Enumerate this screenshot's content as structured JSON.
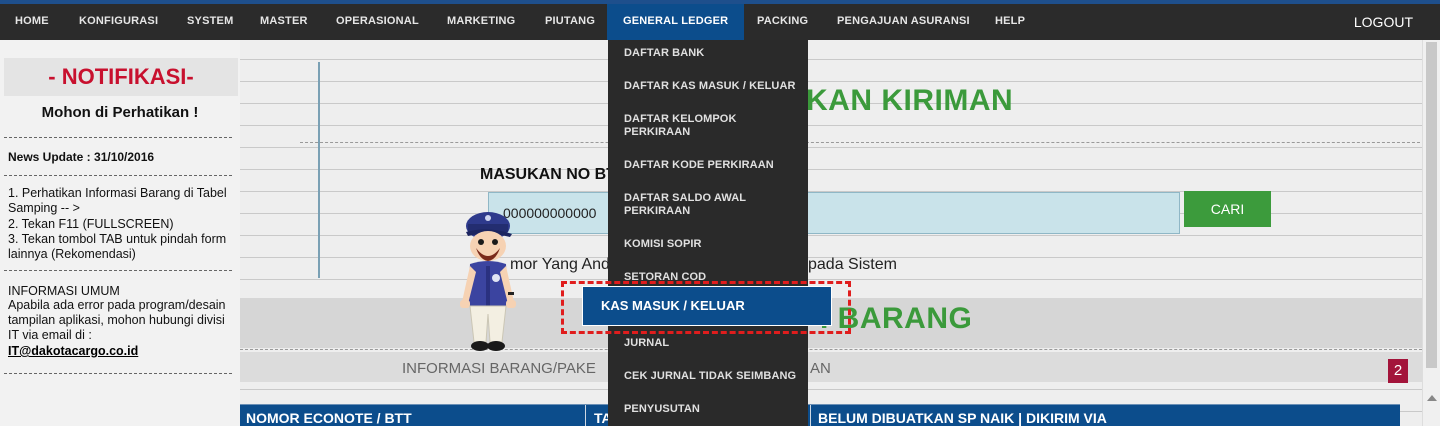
{
  "nav": {
    "items": [
      "HOME",
      "KONFIGURASI",
      "SYSTEM",
      "MASTER",
      "OPERASIONAL",
      "MARKETING",
      "PIUTANG",
      "GENERAL LEDGER",
      "PACKING",
      "PENGAJUAN ASURANSI",
      "HELP"
    ],
    "active": "GENERAL LEDGER",
    "logout": "LOGOUT"
  },
  "sidebar": {
    "title": "- NOTIFIKASI-",
    "subtitle": "Mohon di Perhatikan !",
    "news": "News Update : 31/10/2016",
    "steps": [
      "1. Perhatikan Informasi Barang di Tabel Samping -- >",
      "2. Tekan F11 (FULLSCREEN)",
      "3. Tekan tombol TAB untuk pindah form lainnya (Rekomendasi)"
    ],
    "info_title": "INFORMASI UMUM",
    "info_text": "Apabila ada error pada program/desain tampilan aplikasi, mohon hubungi divisi IT via email di :",
    "email": "IT@dakotacargo.co.id"
  },
  "main": {
    "heading1": "KAN KIRIMAN",
    "field_label": "MASUKAN NO BT",
    "input_value": "000000000000",
    "search_button": "CARI",
    "info_line_left": "mor Yang Anda",
    "info_line_right": "pada Sistem",
    "heading2": "I BARANG",
    "info_band_left": "INFORMASI BARANG/PAKE",
    "info_band_right": "AN",
    "badge": "2",
    "table_headers": [
      "NOMOR ECONOTE / BTT",
      "TA",
      "BELUM DIBUATKAN SP NAIK | DIKIRIM VIA"
    ]
  },
  "dropdown": {
    "items": [
      "DAFTAR BANK",
      "DAFTAR KAS MASUK / KELUAR",
      "DAFTAR KELOMPOK PERKIRAAN",
      "DAFTAR KODE PERKIRAAN",
      "DAFTAR SALDO AWAL PERKIRAAN",
      "KOMISI SOPIR",
      "SETORAN COD",
      "JURNAL",
      "CEK JURNAL TIDAK SEIMBANG",
      "PENYUSUTAN"
    ],
    "highlighted": "KAS MASUK / KELUAR"
  },
  "colors": {
    "nav_bg": "#2b2b2b",
    "accent_blue": "#0c4d8c",
    "green": "#3b9a3b",
    "notif_red": "#c8102e",
    "badge_red": "#a3143a",
    "callout_red": "#e01d1d"
  }
}
